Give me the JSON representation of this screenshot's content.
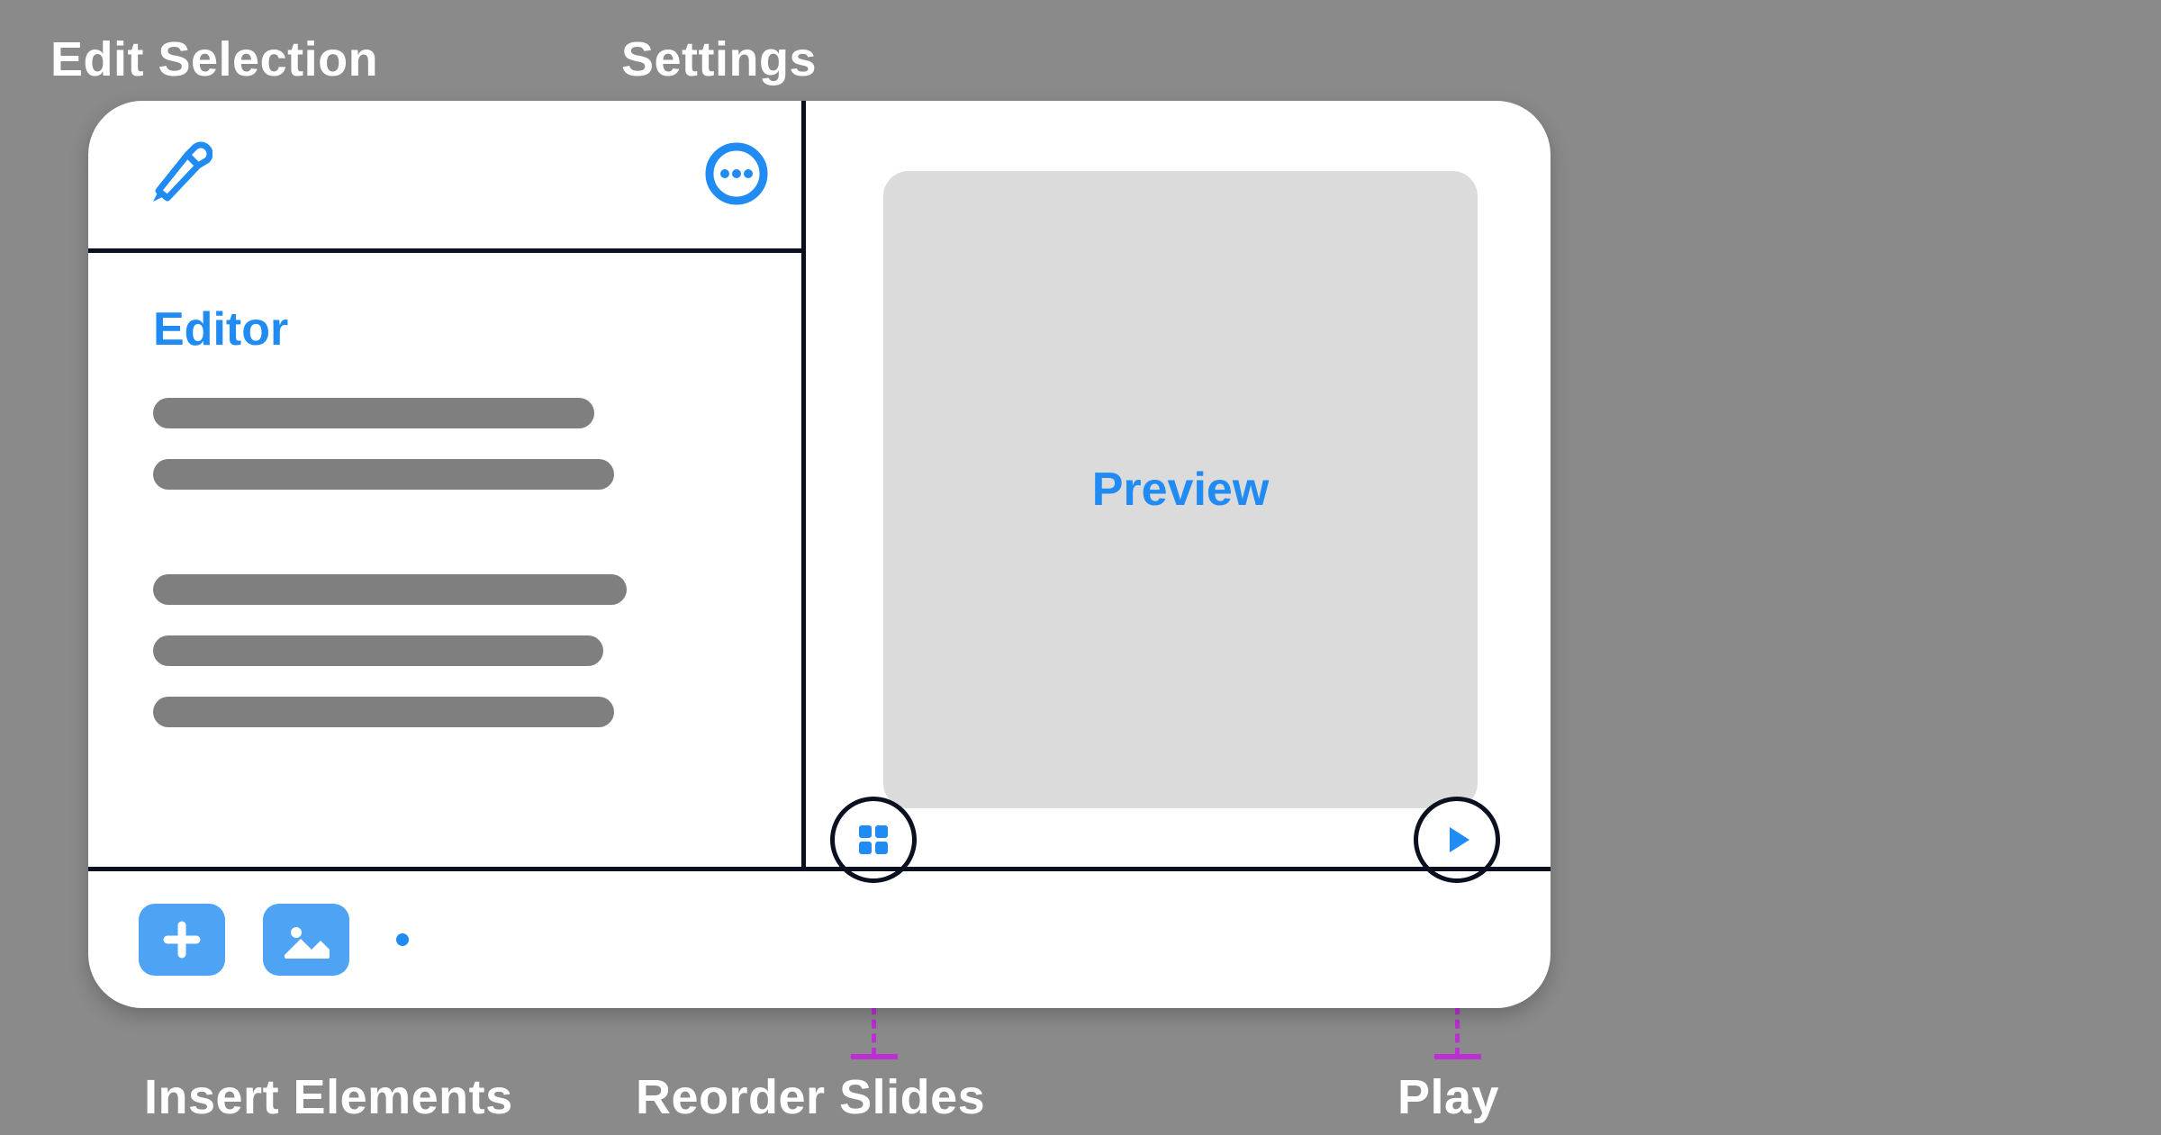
{
  "colors": {
    "accent": "#208bf3",
    "accent_fill": "#4ea3f4",
    "annotation": "#bd2fd4",
    "line": "#0b1021",
    "bg": "#8a8a8a",
    "placeholder": "#7f7f7f",
    "preview_bg": "#dbdbdb"
  },
  "annotations": {
    "edit_selection": "Edit Selection",
    "settings": "Settings",
    "insert_elements": "Insert Elements",
    "reorder_slides": "Reorder Slides",
    "play": "Play"
  },
  "toolbar": {
    "brush_icon": "brush-icon",
    "more_icon": "more-circle-icon"
  },
  "editor": {
    "title": "Editor"
  },
  "preview": {
    "title": "Preview",
    "reorder_icon": "grid-icon",
    "play_icon": "play-icon"
  },
  "footer": {
    "add_icon": "plus-icon",
    "image_icon": "image-icon",
    "more_icon": "dots-icon"
  }
}
